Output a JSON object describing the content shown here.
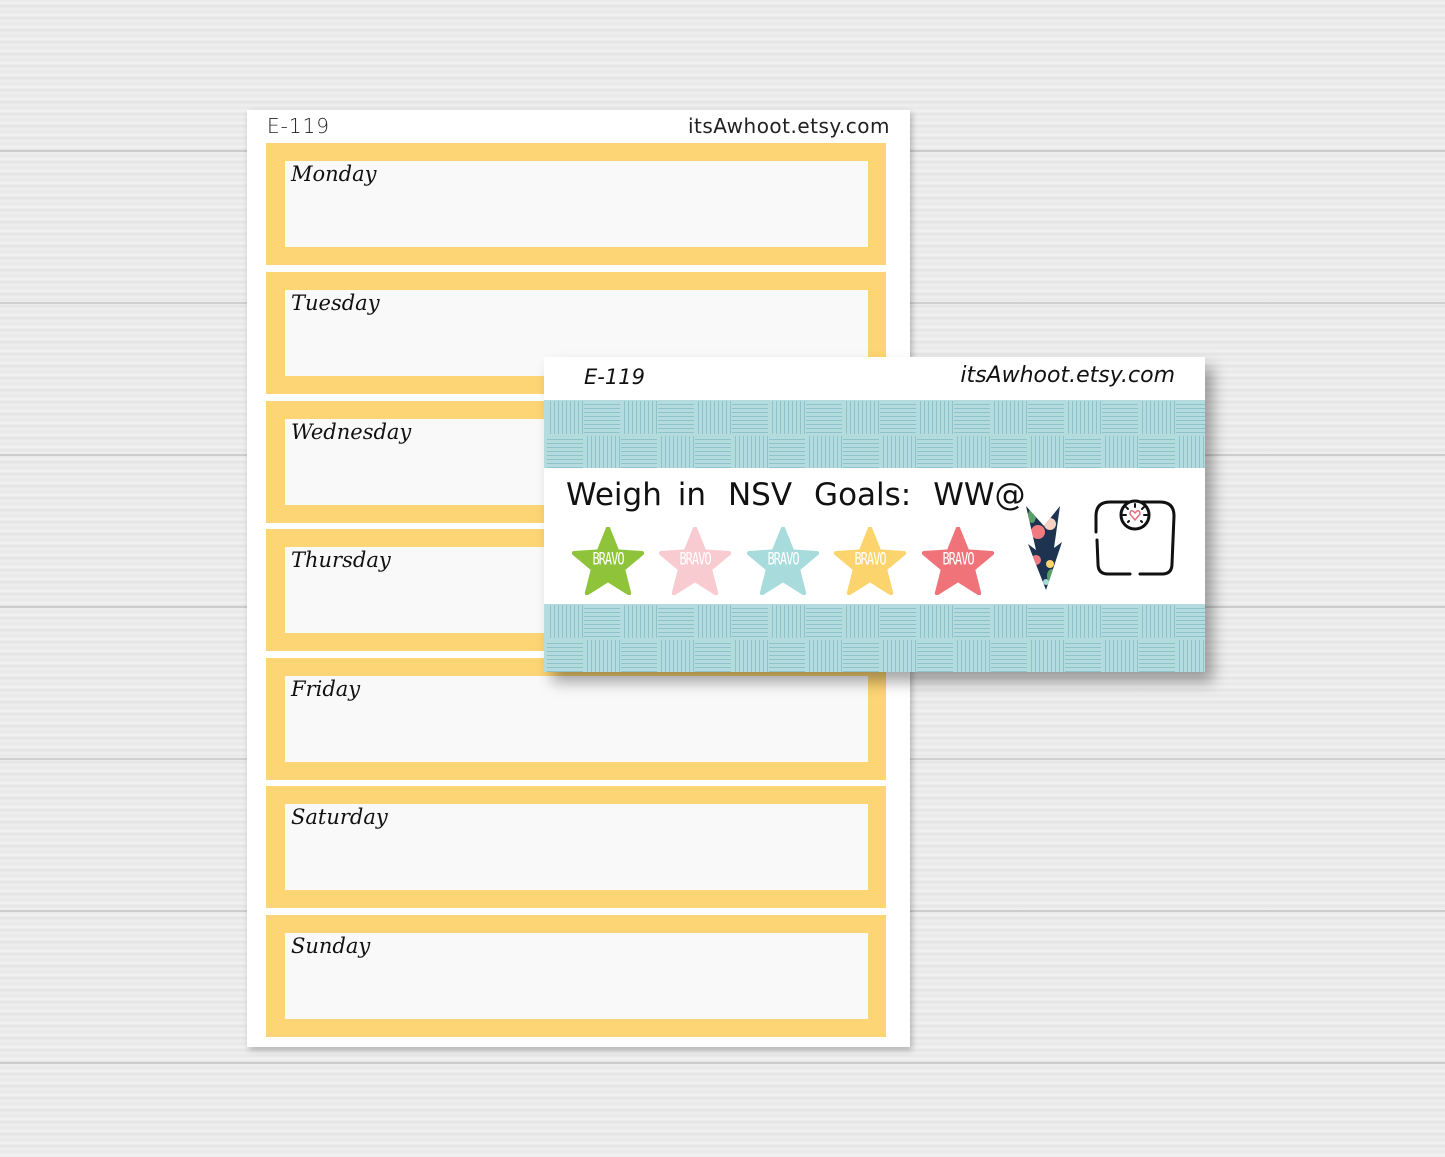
{
  "background": {
    "description": "white washed wood planks",
    "color": "#ececec"
  },
  "large_sheet": {
    "code": "E-119",
    "shop": "itsAwhoot.etsy.com",
    "box_color": "#fdd574",
    "days": [
      {
        "label": "Monday"
      },
      {
        "label": "Tuesday"
      },
      {
        "label": "Wednesday"
      },
      {
        "label": "Thursday"
      },
      {
        "label": "Friday"
      },
      {
        "label": "Saturday"
      },
      {
        "label": "Sunday"
      }
    ]
  },
  "small_sticker": {
    "code": "E-119",
    "shop": "itsAwhoot.etsy.com",
    "band_color": "#b4dcdf",
    "labels": [
      "Weigh in",
      "NSV",
      "Goals:",
      "WW@"
    ],
    "stars": [
      {
        "text": "BRAVO",
        "color": "#8fc33a"
      },
      {
        "text": "BRAVO",
        "color": "#f8cbd0"
      },
      {
        "text": "BRAVO",
        "color": "#a8dcdc"
      },
      {
        "text": "BRAVO",
        "color": "#fbd46e"
      },
      {
        "text": "BRAVO",
        "color": "#ef7379"
      }
    ],
    "icons": [
      "floral-down-arrow-icon",
      "bathroom-scale-icon"
    ]
  }
}
